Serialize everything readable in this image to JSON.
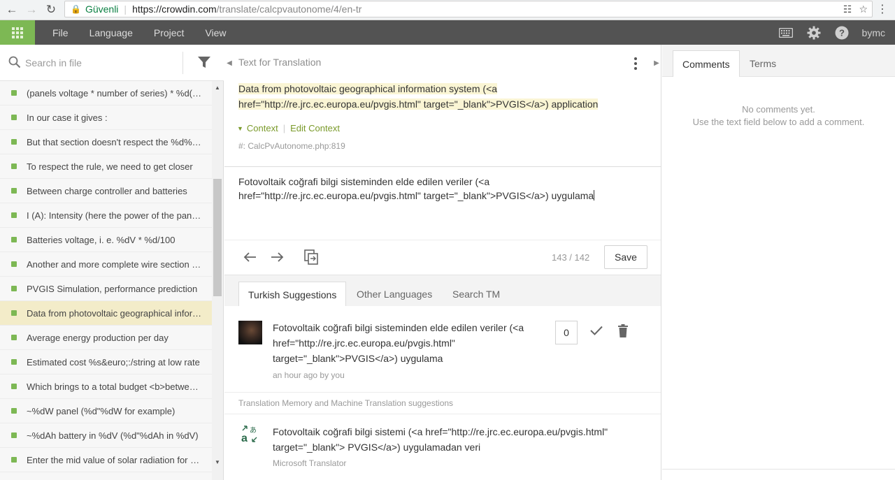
{
  "browser": {
    "secure_label": "Güvenli",
    "url_host": "https://crowdin.com",
    "url_path": "/translate/calcpvautonome/4/en-tr"
  },
  "header": {
    "menu": [
      "File",
      "Language",
      "Project",
      "View"
    ],
    "username": "bymc",
    "colors": {
      "bar": "#535353",
      "apps_button": "#7db854"
    }
  },
  "left": {
    "search_placeholder": "Search in file",
    "items": [
      "(panels voltage * number of series) * %d(dV) = %d(dV)",
      "In our case it gives :",
      "But that section doesn't respect the %d% rule",
      "To respect the rule, we need to get closer",
      "Between charge controller and batteries",
      "I (A): Intensity (here the power of the panels)",
      "Batteries voltage, i. e. %dV * %d/100",
      "Another and more complete wire section calculation",
      "PVGIS Simulation, performance prediction",
      "Data from photovoltaic geographical information system",
      "Average energy production per day",
      "Estimated cost %s&euro;:/string at low rate",
      "Which brings to a total budget <b>between</b>",
      "~%dW panel (%d\"%dW for example)",
      "~%dAh battery in %dV (%d\"%dAh in %dV)",
      "Enter the mid value of solar radiation for your site"
    ],
    "active_index": 9
  },
  "center": {
    "panel_label": "Text for Translation",
    "source_text": {
      "part1": "Data from photovoltaic geographical information system (",
      "tag_open": "<a href=\"http://re.jrc.ec.europa.eu/pvgis.html\" target=\"_blank\">",
      "link_text": "PVGIS",
      "tag_close": "</a>",
      "part2": ") application"
    },
    "context_link": "Context",
    "edit_context_link": "Edit Context",
    "context_file": "#: CalcPvAutonome.php:819",
    "translation_text": "Fotovoltaik coğrafi bilgi sisteminden elde edilen veriler (<a href=\"http://re.jrc.ec.europa.eu/pvgis.html\" target=\"_blank\">PVGIS</a>) uygulama",
    "counter": "143 / 142",
    "save_label": "Save",
    "tabs": [
      "Turkish Suggestions",
      "Other Languages",
      "Search TM"
    ],
    "suggestion": {
      "text": "Fotovoltaik coğrafi bilgi sisteminden elde edilen veriler (<a href=\"http://re.jrc.ec.europa.eu/pvgis.html\" target=\"_blank\">PVGIS</a>) uygulama",
      "meta": "an hour ago by you",
      "votes": "0"
    },
    "tm_label": "Translation Memory and Machine Translation suggestions",
    "mt": {
      "text": "Fotovoltaik coğrafi bilgi sistemi (<a href=\"http://re.jrc.ec.europa.eu/pvgis.html\" target=\"_blank\"> PVGIS</a>) uygulamadan veri",
      "source": "Microsoft Translator"
    }
  },
  "right": {
    "tabs": [
      "Comments",
      "Terms"
    ],
    "no_comments_line1": "No comments yet.",
    "no_comments_line2": "Use the text field below to add a comment."
  }
}
